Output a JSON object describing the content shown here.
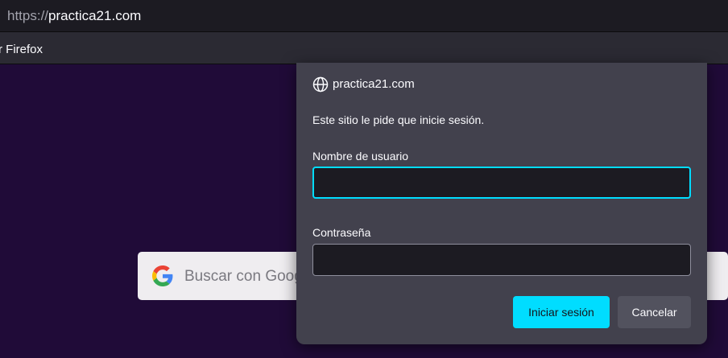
{
  "browser": {
    "url_scheme": "https://",
    "url_host": "practica21.com",
    "bookmark_item": "r Firefox"
  },
  "page": {
    "search_placeholder": "Buscar con Goog",
    "search_icon": "google-g-icon"
  },
  "dialog": {
    "site_icon": "globe-icon",
    "site": "practica21.com",
    "message": "Este sitio le pide que inicie sesión.",
    "username_label": "Nombre de usuario",
    "username_value": "",
    "password_label": "Contraseña",
    "password_value": "",
    "login_button": "Iniciar sesión",
    "cancel_button": "Cancelar"
  },
  "colors": {
    "accent": "#00ddff",
    "dialog_bg": "#42414d",
    "page_bg": "#200b38"
  }
}
